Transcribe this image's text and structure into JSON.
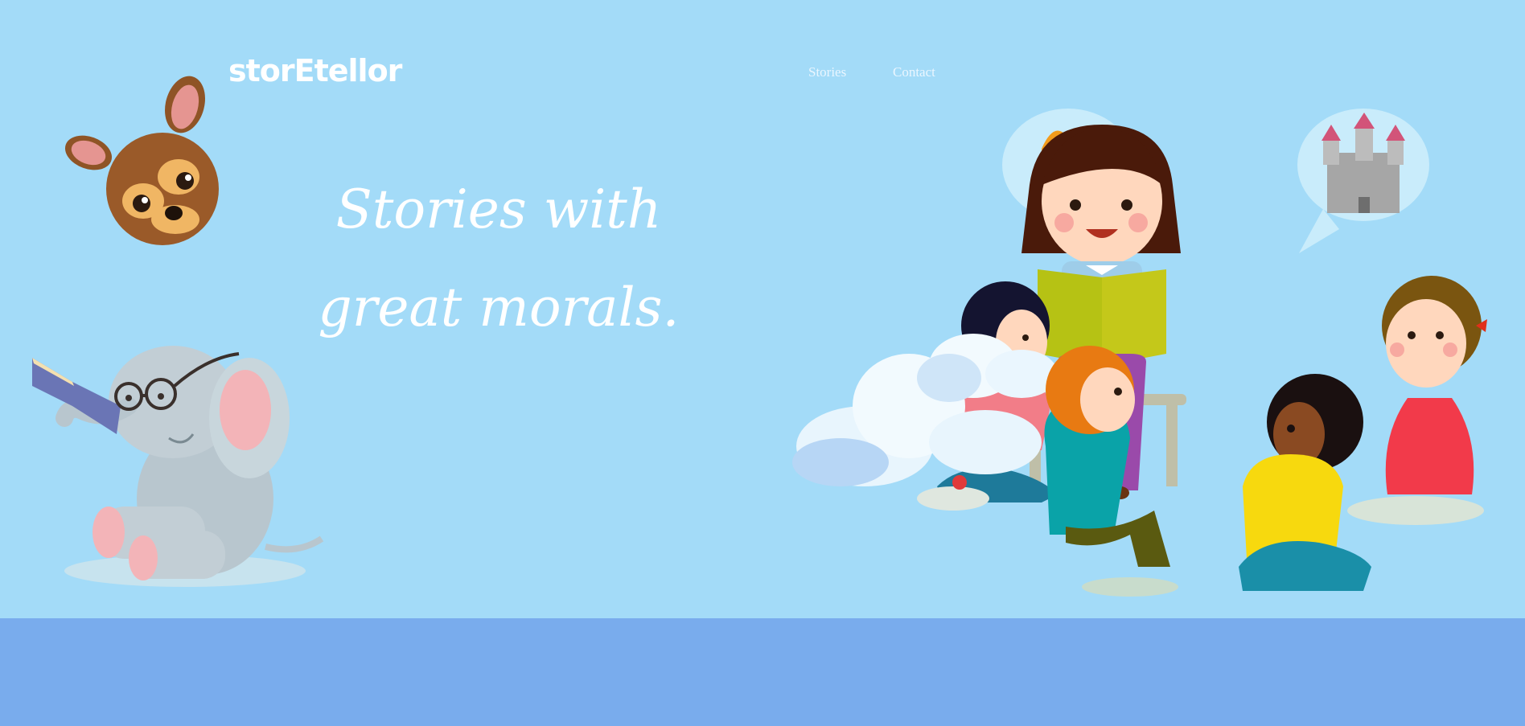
{
  "header": {
    "brand": "storEtellor",
    "nav": [
      {
        "label": "Stories"
      },
      {
        "label": "Contact"
      }
    ]
  },
  "hero": {
    "tagline": "Stories with great morals."
  },
  "colors": {
    "hero_bg": "#a3dbf8",
    "bottom_band": "#79aced",
    "text": "#ffffff"
  },
  "illustrations": [
    {
      "name": "deer-mascot-icon"
    },
    {
      "name": "reading-elephant-illustration"
    },
    {
      "name": "storytelling-kids-illustration"
    }
  ]
}
